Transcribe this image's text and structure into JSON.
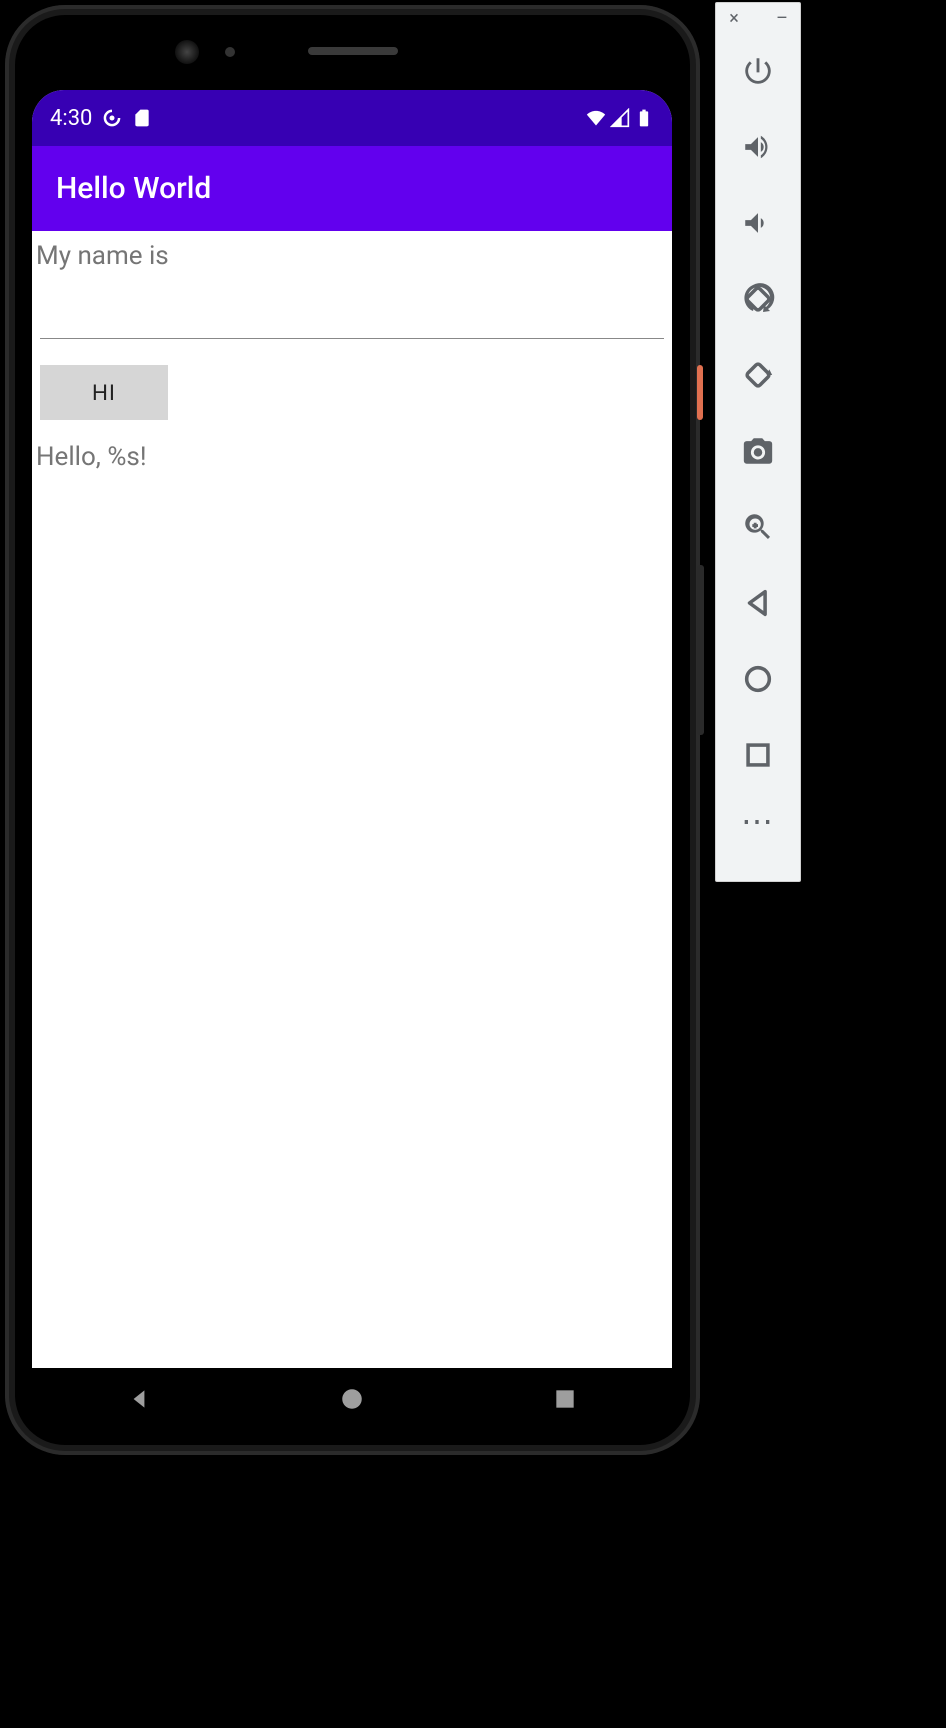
{
  "statusBar": {
    "time": "4:30"
  },
  "appBar": {
    "title": "Hello World"
  },
  "content": {
    "nameLabel": "My name is",
    "inputValue": "",
    "buttonLabel": "HI",
    "greeting": "Hello, %s!"
  },
  "emulator": {
    "close": "×",
    "minimize": "–",
    "more": "⋯"
  }
}
